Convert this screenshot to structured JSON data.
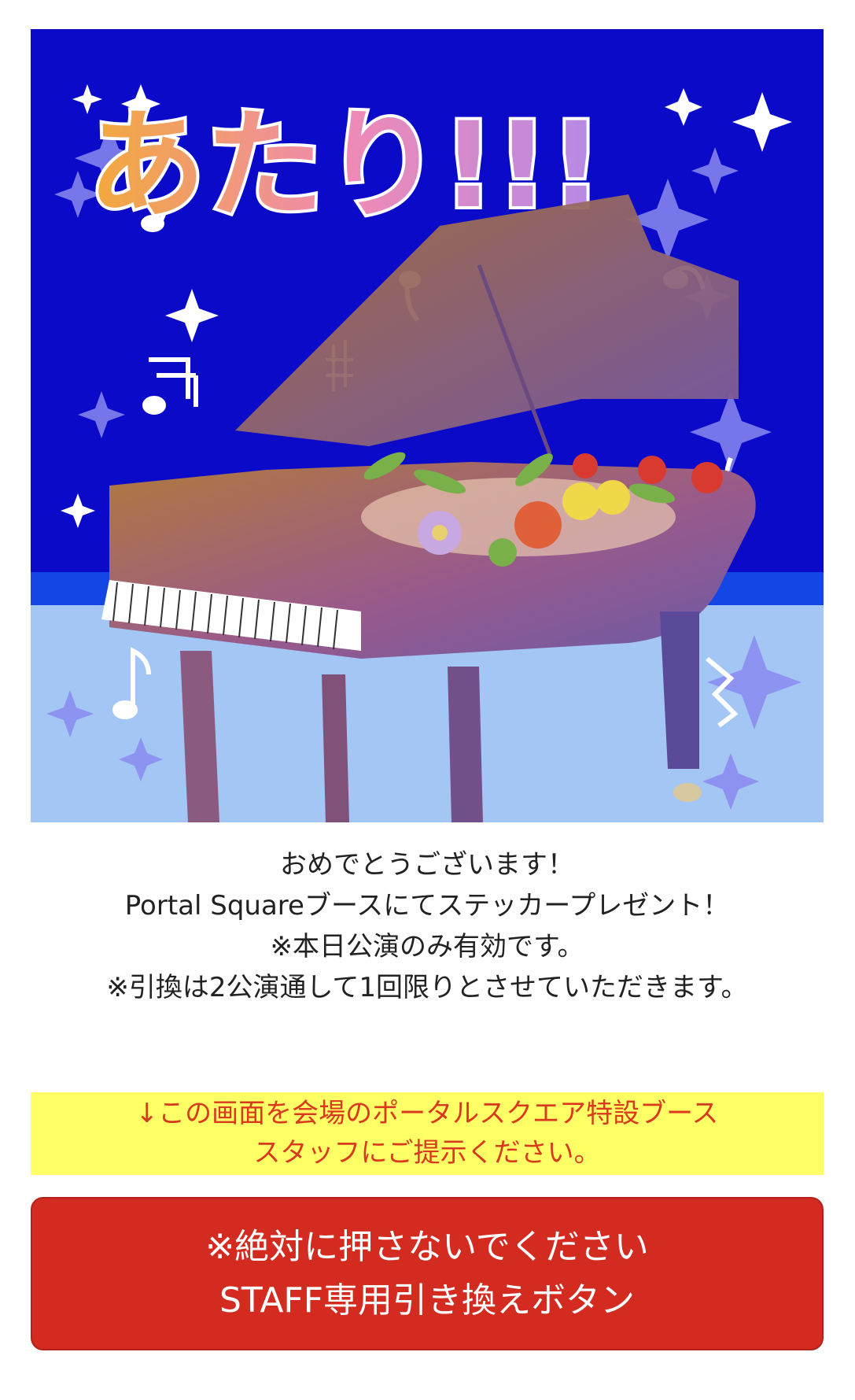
{
  "hero": {
    "headline": "あたり!!!",
    "colors": {
      "sky": "#0a0ac8",
      "floor": "#a3c6f5",
      "floor_edge": "#1446e6",
      "headline_gradient": [
        "#f2a93a",
        "#f08ab4",
        "#b48ae8"
      ]
    }
  },
  "message": {
    "lines": [
      "おめでとうございます！",
      "Portal Squareブースにてステッカープレゼント！",
      "※本日公演のみ有効です。",
      "※引換は2公演通して1回限りとさせていただきます。"
    ]
  },
  "notice": {
    "lines": [
      "↓この画面を会場のポータルスクエア特設ブース",
      "スタッフにご提示ください。"
    ],
    "background": "#ffff66",
    "color": "#d93a1e"
  },
  "staff_button": {
    "line1": "※絶対に押さないでください",
    "line2": "STAFF専用引き換えボタン",
    "color": "#d32b20"
  }
}
